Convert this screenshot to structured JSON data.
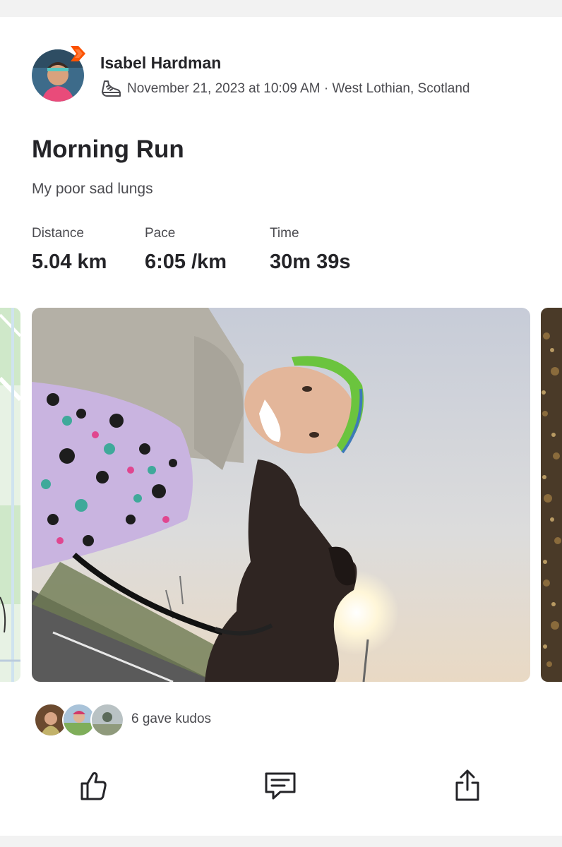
{
  "activity": {
    "athlete_name": "Isabel Hardman",
    "datetime": "November 21, 2023 at 10:09 AM",
    "separator": " · ",
    "location": "West Lothian, Scotland",
    "sport_icon": "shoe-icon",
    "title": "Morning Run",
    "description": "My poor sad lungs"
  },
  "stats": [
    {
      "label": "Distance",
      "value": "5.04 km"
    },
    {
      "label": "Pace",
      "value": "6:05 /km"
    },
    {
      "label": "Time",
      "value": "30m 39s"
    }
  ],
  "media": {
    "items": [
      "map-thumbnail",
      "selfie-photo",
      "leaves-photo"
    ]
  },
  "kudos": {
    "text": "6 gave kudos",
    "avatar_count_shown": 3
  },
  "actions": [
    {
      "name": "kudos",
      "icon": "thumbs-up-icon"
    },
    {
      "name": "comment",
      "icon": "comment-icon"
    },
    {
      "name": "share",
      "icon": "share-icon"
    }
  ],
  "colors": {
    "brand_orange": "#fc5200",
    "text_primary": "#242428",
    "text_secondary": "#4b4b50",
    "background": "#f2f2f2"
  }
}
